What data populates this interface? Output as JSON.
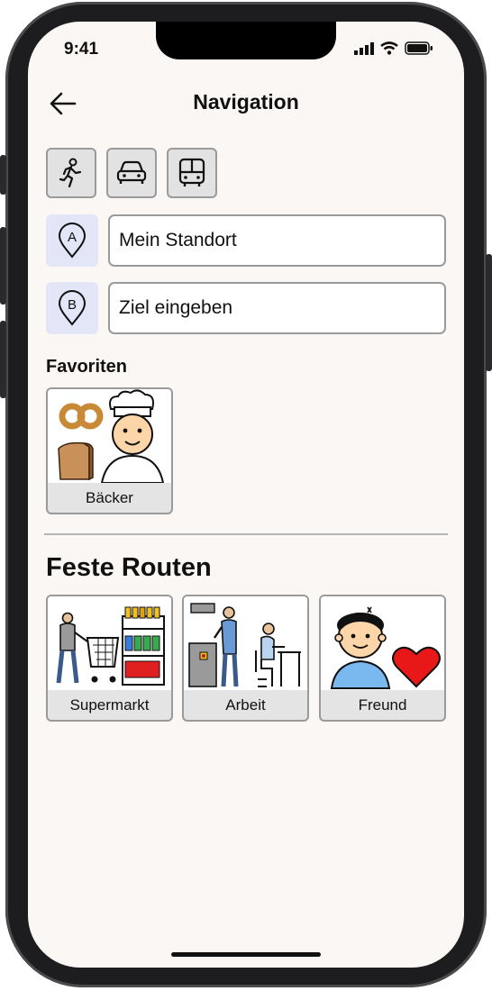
{
  "status_bar": {
    "time": "9:41"
  },
  "header": {
    "title": "Navigation",
    "back_icon": "arrow-left-icon"
  },
  "transport_modes": [
    {
      "name": "walk",
      "icon": "walking-person-icon"
    },
    {
      "name": "car",
      "icon": "car-icon"
    },
    {
      "name": "public-transport",
      "icon": "bus-icon"
    }
  ],
  "start": {
    "marker": "A",
    "value": "Mein Standort"
  },
  "destination": {
    "marker": "B",
    "placeholder": "Ziel eingeben"
  },
  "favorites": {
    "title": "Favoriten",
    "items": [
      {
        "label": "Bäcker"
      }
    ]
  },
  "routes": {
    "title": "Feste Routen",
    "items": [
      {
        "label": "Supermarkt"
      },
      {
        "label": "Arbeit"
      },
      {
        "label": "Freund"
      }
    ]
  },
  "colors": {
    "background": "#fbf7f4",
    "tile": "#e4e4e4",
    "pin_bg": "#e3e6f7",
    "border": "#9a9a9a"
  }
}
